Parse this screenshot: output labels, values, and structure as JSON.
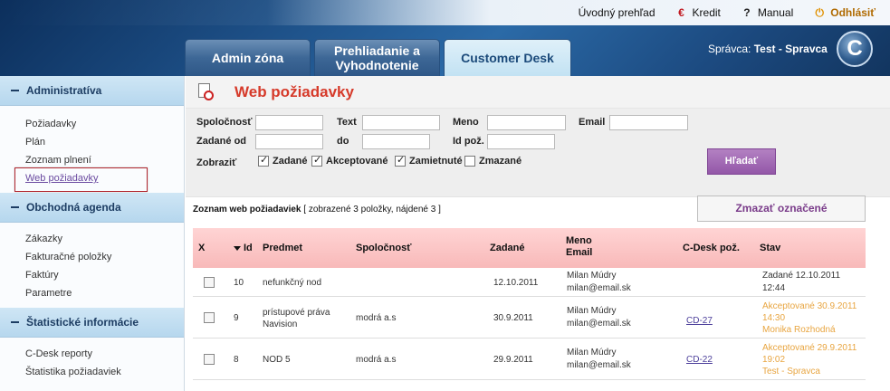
{
  "top_links": {
    "overview": "Úvodný prehľad",
    "credit": "Kredit",
    "manual": "Manual",
    "logout": "Odhlásiť"
  },
  "tabs": [
    {
      "label": "Admin zóna",
      "active": false
    },
    {
      "label": "Prehliadanie a\nVyhodnotenie",
      "active": false
    },
    {
      "label": "Customer Desk",
      "active": true
    }
  ],
  "admin": {
    "prefix": "Správca:",
    "name": "Test - Spravca"
  },
  "logo_letter": "C",
  "sidebar": {
    "sections": [
      {
        "title": "Administratíva",
        "items": [
          "Požiadavky",
          "Plán",
          "Zoznam plnení",
          "Web požiadavky"
        ]
      },
      {
        "title": "Obchodná agenda",
        "items": [
          "Zákazky",
          "Fakturačné položky",
          "Faktúry",
          "Parametre"
        ]
      },
      {
        "title": "Štatistické informácie",
        "items": [
          "C-Desk reporty",
          "Štatistika požiadaviek"
        ]
      }
    ],
    "highlighted_item": "Web požiadavky"
  },
  "page_title": "Web požiadavky",
  "filter": {
    "company_label": "Spoločnosť",
    "text_label": "Text",
    "name_label": "Meno",
    "email_label": "Email",
    "entered_from_label": "Zadané od",
    "to_label": "do",
    "id_label": "Id pož.",
    "show_label": "Zobraziť",
    "checkboxes": [
      {
        "label": "Zadané",
        "checked": true
      },
      {
        "label": "Akceptované",
        "checked": true
      },
      {
        "label": "Zamietnuté",
        "checked": true
      },
      {
        "label": "Zmazané",
        "checked": false
      }
    ],
    "search_button": "Hľadať"
  },
  "list": {
    "title": "Zoznam web požiadaviek",
    "summary": "[ zobrazené 3 položky, nájdené 3 ]",
    "delete_button": "Zmazať označené"
  },
  "table": {
    "headers": {
      "x": "X",
      "id": "Id",
      "subject": "Predmet",
      "company": "Spoločnosť",
      "entered": "Zadané",
      "name": "Meno",
      "email": "Email",
      "cdesk": "C-Desk pož.",
      "status": "Stav"
    },
    "rows": [
      {
        "id": "10",
        "subject": "nefunkčný nod",
        "company": "",
        "entered": "12.10.2011",
        "name": "Milan Múdry",
        "email": "milan@email.sk",
        "cdesk": "",
        "status": [
          "Zadané 12.10.2011",
          "12:44"
        ],
        "status_type": "done"
      },
      {
        "id": "9",
        "subject": "prístupové práva\nNavision",
        "company": "modrá a.s",
        "entered": "30.9.2011",
        "name": "Milan Múdry",
        "email": "milan@email.sk",
        "cdesk": "CD-27",
        "status": [
          "Akceptované 30.9.2011",
          "14:30",
          "Monika Rozhodná"
        ],
        "status_type": "accepted"
      },
      {
        "id": "8",
        "subject": "NOD 5",
        "company": "modrá a.s",
        "entered": "29.9.2011",
        "name": "Milan Múdry",
        "email": "milan@email.sk",
        "cdesk": "CD-22",
        "status": [
          "Akceptované 29.9.2011",
          "19:02",
          "Test - Spravca"
        ],
        "status_type": "accepted"
      }
    ]
  },
  "colors": {
    "title_red": "#d63a2a",
    "accepted_orange": "#e8a540",
    "search_button": "#9357a8",
    "table_header": "#f8b9b9"
  }
}
